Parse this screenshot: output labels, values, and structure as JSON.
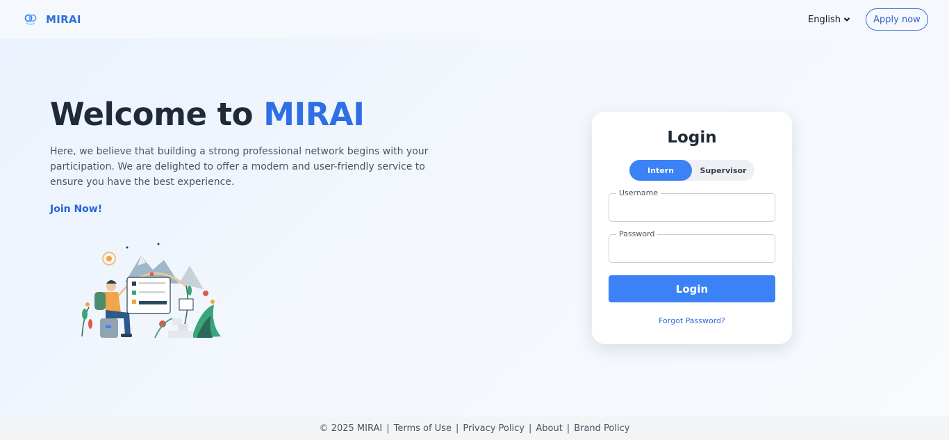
{
  "header": {
    "brand": "MIRAI",
    "language": "English",
    "apply_label": "Apply now"
  },
  "hero": {
    "title_prefix": "Welcome to ",
    "title_accent": "MIRAI",
    "description": "Here, we believe that building a strong professional network begins with your participation. We are delighted to offer a modern and user-friendly service to ensure you have the best experience.",
    "join_label": "Join Now!"
  },
  "login": {
    "title": "Login",
    "roles": [
      "Intern",
      "Supervisor"
    ],
    "active_role": "Intern",
    "username_label": "Username",
    "username_value": "",
    "password_label": "Password",
    "password_value": "",
    "submit_label": "Login",
    "forgot_label": "Forgot Password?"
  },
  "footer": {
    "copyright": "© 2025 MIRAI",
    "links": [
      "Terms of Use",
      "Privacy Policy",
      "About",
      "Brand Policy"
    ]
  },
  "colors": {
    "accent": "#2f6fe6",
    "button": "#3b82f6",
    "text": "#1f2937"
  }
}
